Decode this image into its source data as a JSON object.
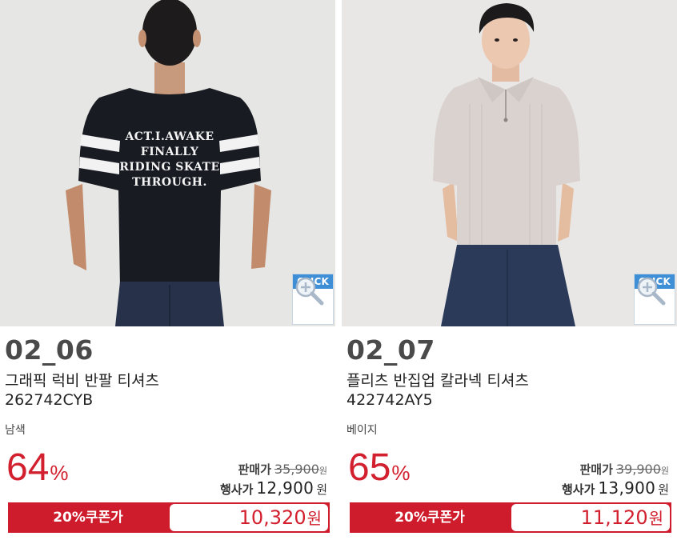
{
  "products": [
    {
      "image_icon": "product-photo-black-rugby-tee-back",
      "click_label": "CLICK",
      "code": "02_06",
      "name": "그래픽 럭비 반팔 티셔츠",
      "product_code": "262742CYB",
      "color": "남색",
      "discount_value": "64",
      "discount_unit": "%",
      "list_price_label": "판매가",
      "list_price": "35,900",
      "list_price_unit": "원",
      "event_price_label": "행사가",
      "event_price": "12,900",
      "event_price_unit": "원",
      "coupon_label": "20%쿠폰가",
      "coupon_price": "10,320",
      "coupon_price_unit": "원",
      "tee_print": [
        "ACT.I.AWAKE",
        "FINALLY",
        "RIDING SKATE",
        "THROUGH."
      ]
    },
    {
      "image_icon": "product-photo-beige-pleats-halfzip-polo",
      "click_label": "CLICK",
      "code": "02_07",
      "name": "플리츠 반집업 칼라넥 티셔츠",
      "product_code": "422742AY5",
      "color": "베이지",
      "discount_value": "65",
      "discount_unit": "%",
      "list_price_label": "판매가",
      "list_price": "39,900",
      "list_price_unit": "원",
      "event_price_label": "행사가",
      "event_price": "13,900",
      "event_price_unit": "원",
      "coupon_label": "20%쿠폰가",
      "coupon_price": "11,120",
      "coupon_price_unit": "원"
    }
  ],
  "colors": {
    "accent_red": "#cf1c2c",
    "click_blue": "#3f8fd6",
    "photo_bg": "#e7e7e5"
  }
}
